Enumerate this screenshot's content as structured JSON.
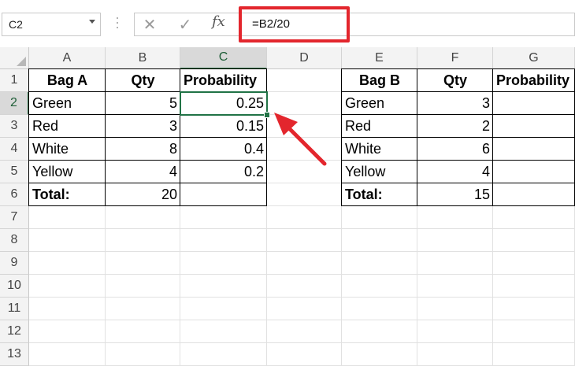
{
  "name_box": {
    "value": "C2"
  },
  "formula_bar": {
    "cancel_icon": "close-icon",
    "enter_icon": "check-icon",
    "fx_label": "fx",
    "formula": "=B2/20"
  },
  "columns": [
    "A",
    "B",
    "C",
    "D",
    "E",
    "F",
    "G"
  ],
  "rows": [
    "1",
    "2",
    "3",
    "4",
    "5",
    "6",
    "7",
    "8",
    "9",
    "10",
    "11",
    "12",
    "13"
  ],
  "active_cell": "C2",
  "table_a": {
    "headers": [
      "Bag A",
      "Qty",
      "Probability"
    ],
    "rows": [
      [
        "Green",
        "5",
        "0.25"
      ],
      [
        "Red",
        "3",
        "0.15"
      ],
      [
        "White",
        "8",
        "0.4"
      ],
      [
        "Yellow",
        "4",
        "0.2"
      ]
    ],
    "total_label": "Total:",
    "total_value": "20"
  },
  "table_b": {
    "headers": [
      "Bag B",
      "Qty",
      "Probability"
    ],
    "rows": [
      [
        "Green",
        "3",
        ""
      ],
      [
        "Red",
        "2",
        ""
      ],
      [
        "White",
        "6",
        ""
      ],
      [
        "Yellow",
        "4",
        ""
      ]
    ],
    "total_label": "Total:",
    "total_value": "15"
  },
  "colors": {
    "highlight_box": "#e3262d",
    "selection": "#217346",
    "arrow": "#e3262d"
  }
}
